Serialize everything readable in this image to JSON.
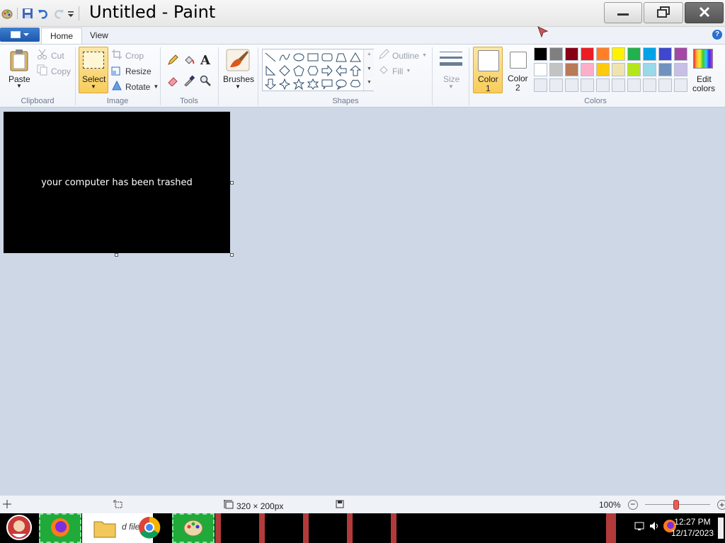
{
  "window": {
    "title": "Untitled - Paint"
  },
  "ribbon_tabs": [
    {
      "label": "Home",
      "active": true
    },
    {
      "label": "View",
      "active": false
    }
  ],
  "clipboard": {
    "paste": "Paste",
    "cut": "Cut",
    "copy": "Copy",
    "group": "Clipboard"
  },
  "image": {
    "select": "Select",
    "crop": "Crop",
    "resize": "Resize",
    "rotate": "Rotate",
    "group": "Image"
  },
  "tools": {
    "group": "Tools",
    "items": [
      "pencil-icon",
      "fill-bucket-icon",
      "text-icon",
      "eraser-icon",
      "color-picker-icon",
      "magnifier-icon"
    ]
  },
  "brushes": {
    "label": "Brushes"
  },
  "shapes": {
    "group": "Shapes",
    "outline": "Outline",
    "fill": "Fill"
  },
  "size": {
    "label": "Size"
  },
  "colors": {
    "group": "Colors",
    "color1": "Color",
    "color1_num": "1",
    "color2": "Color",
    "color2_num": "2",
    "edit_line1": "Edit",
    "edit_line2": "colors",
    "row1": [
      "#000000",
      "#7f7f7f",
      "#880015",
      "#ed1c24",
      "#ff7f27",
      "#fff200",
      "#22b14c",
      "#00a2e8",
      "#3f48cc",
      "#a349a4"
    ],
    "row2": [
      "#ffffff",
      "#c3c3c3",
      "#b97a57",
      "#ffaec9",
      "#ffc90e",
      "#efe4b0",
      "#b5e61d",
      "#99d9ea",
      "#7092be",
      "#c8bfe7"
    ],
    "row3": [
      "#e9edf3",
      "#e9edf3",
      "#e9edf3",
      "#e9edf3",
      "#e9edf3",
      "#e9edf3",
      "#e9edf3",
      "#e9edf3",
      "#e9edf3",
      "#e9edf3"
    ]
  },
  "canvas": {
    "text": "your computer has been trashed"
  },
  "status": {
    "dimensions": "320 × 200px",
    "zoom": "100%"
  },
  "taskbar": {
    "files_label": "d files",
    "time": "12:27 PM",
    "date": "12/17/2023"
  }
}
